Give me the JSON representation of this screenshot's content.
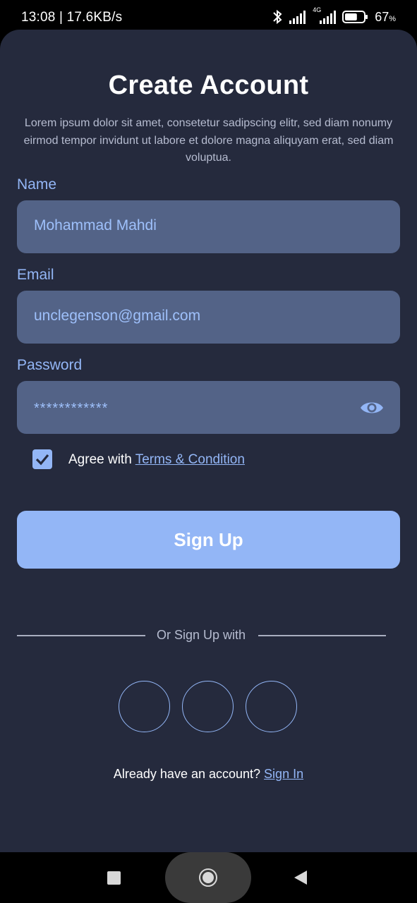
{
  "status_bar": {
    "time_speed": "13:08 | 17.6KB/s",
    "network_type": "4G",
    "battery_percent": "67",
    "battery_unit": "%",
    "battery_level": 0.67
  },
  "form": {
    "title": "Create Account",
    "subtitle": "Lorem ipsum dolor sit amet, consetetur sadipscing elitr, sed diam nonumy eirmod tempor invidunt ut labore et dolore magna aliquyam erat, sed diam voluptua.",
    "name_label": "Name",
    "name_value": "Mohammad Mahdi",
    "email_label": "Email",
    "email_value": "unclegenson@gmail.com",
    "password_label": "Password",
    "password_value": "************",
    "agree_text": "Agree with ",
    "terms_link": "Terms & Condition",
    "agree_checked": true,
    "signup_button": "Sign Up",
    "divider_text": "Or Sign Up with",
    "signin_prompt": "Already have an account? ",
    "signin_link": "Sign In"
  },
  "icons": {
    "eye": "eye-icon",
    "checkbox": "check-icon",
    "bluetooth": "bluetooth-icon",
    "signal": "signal-icon",
    "battery": "battery-icon"
  },
  "colors": {
    "background": "#252a3d",
    "field": "#536387",
    "accent": "#93b6f6",
    "text": "#ffffff"
  }
}
